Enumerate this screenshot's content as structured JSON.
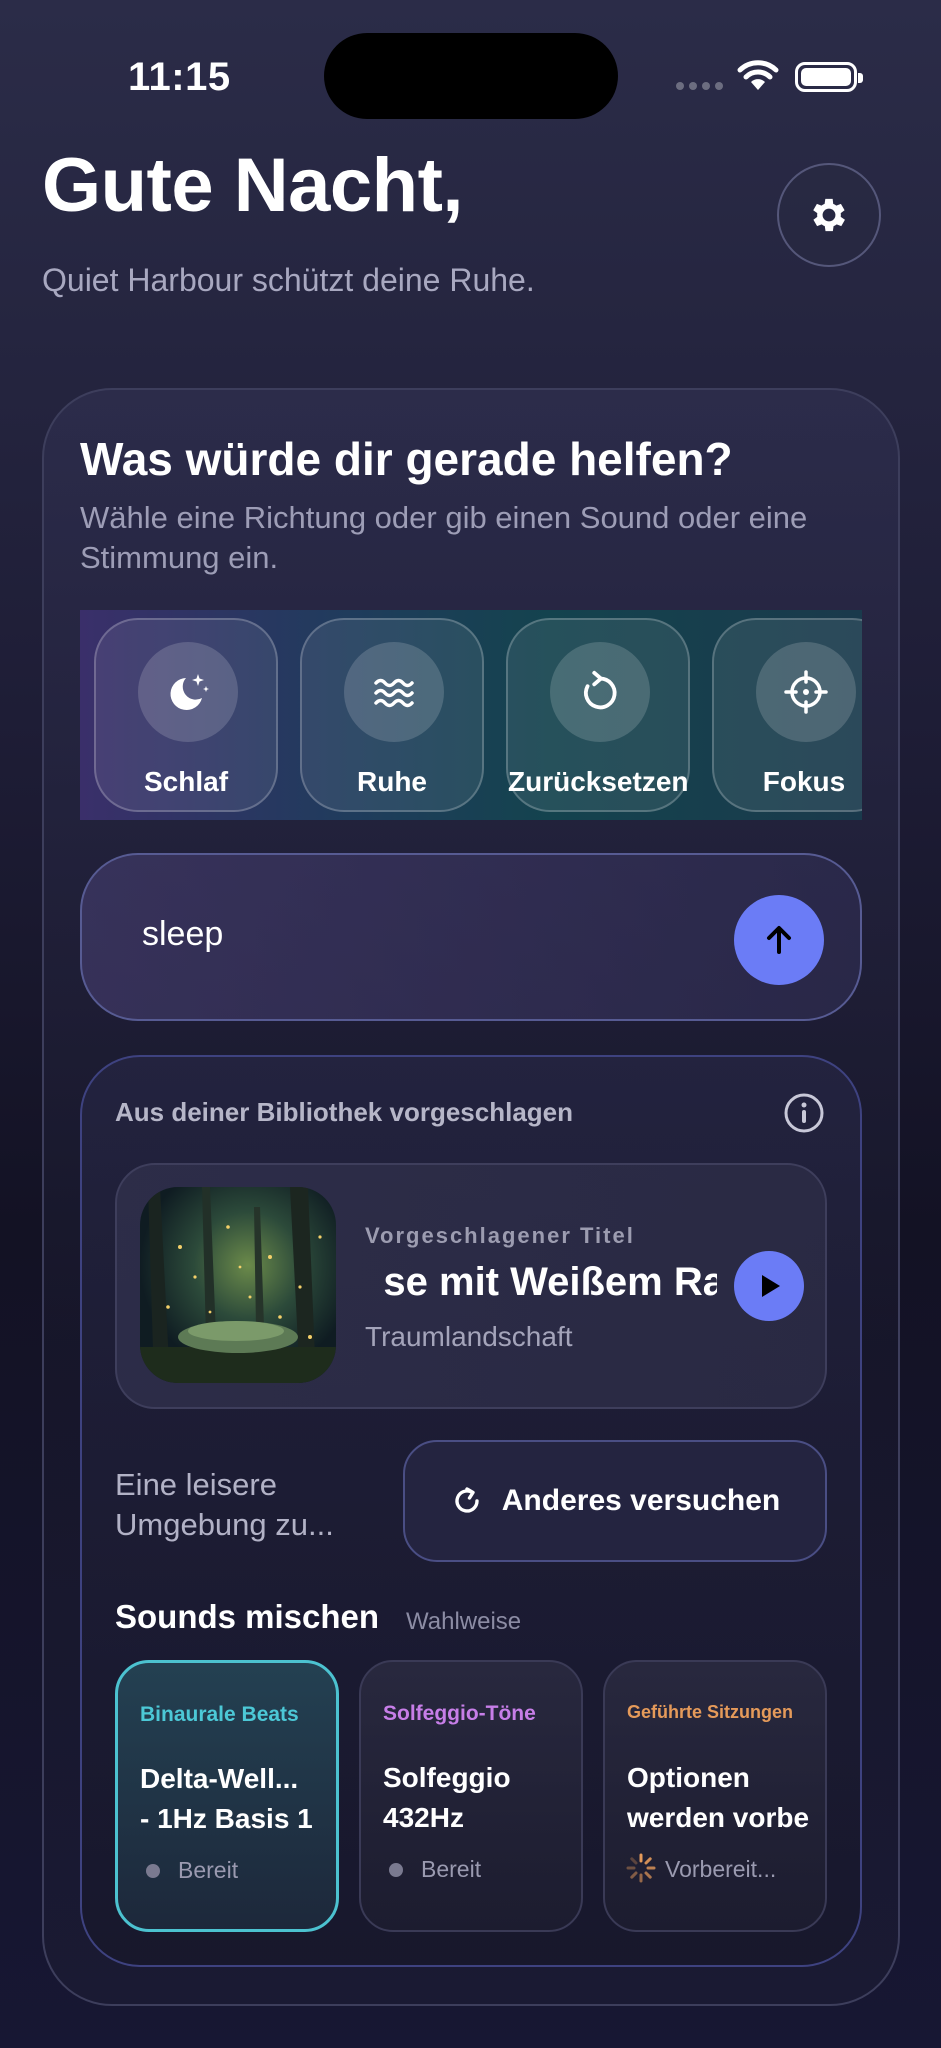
{
  "status_bar": {
    "time": "11:15"
  },
  "header": {
    "greeting": "Gute Nacht,",
    "subtitle": "Quiet Harbour schützt deine Ruhe."
  },
  "prompt": {
    "title": "Was würde dir gerade helfen?",
    "subtitle": "Wähle eine Richtung oder gib einen Sound oder eine Stimmung ein."
  },
  "chips": [
    {
      "label": "Schlaf",
      "icon": "moon-stars-icon"
    },
    {
      "label": "Ruhe",
      "icon": "waves-icon"
    },
    {
      "label": "Zurücksetzen",
      "icon": "reset-icon"
    },
    {
      "label": "Fokus",
      "icon": "crosshair-icon"
    }
  ],
  "search": {
    "value": "sleep"
  },
  "suggestion": {
    "heading": "Aus deiner Bibliothek vorgeschlagen",
    "kicker": "Vorgeschlagener Titel",
    "title": "se mit Weißem Ra",
    "artist": "Traumlandschaft",
    "hint_line1": "Eine leisere",
    "hint_line2": "Umgebung zu...",
    "retry_label": "Anderes versuchen"
  },
  "mix": {
    "title": "Sounds mischen",
    "optional": "Wahlweise",
    "cards": [
      {
        "category": "Binaurale Beats",
        "category_color": "#4cc8d6",
        "name_line1": "Delta-Well...",
        "name_line2": "- 1Hz Basis 1",
        "status": "Bereit"
      },
      {
        "category": "Solfeggio-Töne",
        "category_color": "#c77ee8",
        "name_line1": "Solfeggio",
        "name_line2": "432Hz",
        "status": "Bereit"
      },
      {
        "category": "Geführte Sitzungen",
        "category_color": "#e59a5a",
        "name_line1": "Optionen",
        "name_line2": "werden vorbe",
        "status": "Vorbereit..."
      }
    ]
  },
  "colors": {
    "accent": "#6b7cf6",
    "active_border": "#4cc2d0"
  }
}
